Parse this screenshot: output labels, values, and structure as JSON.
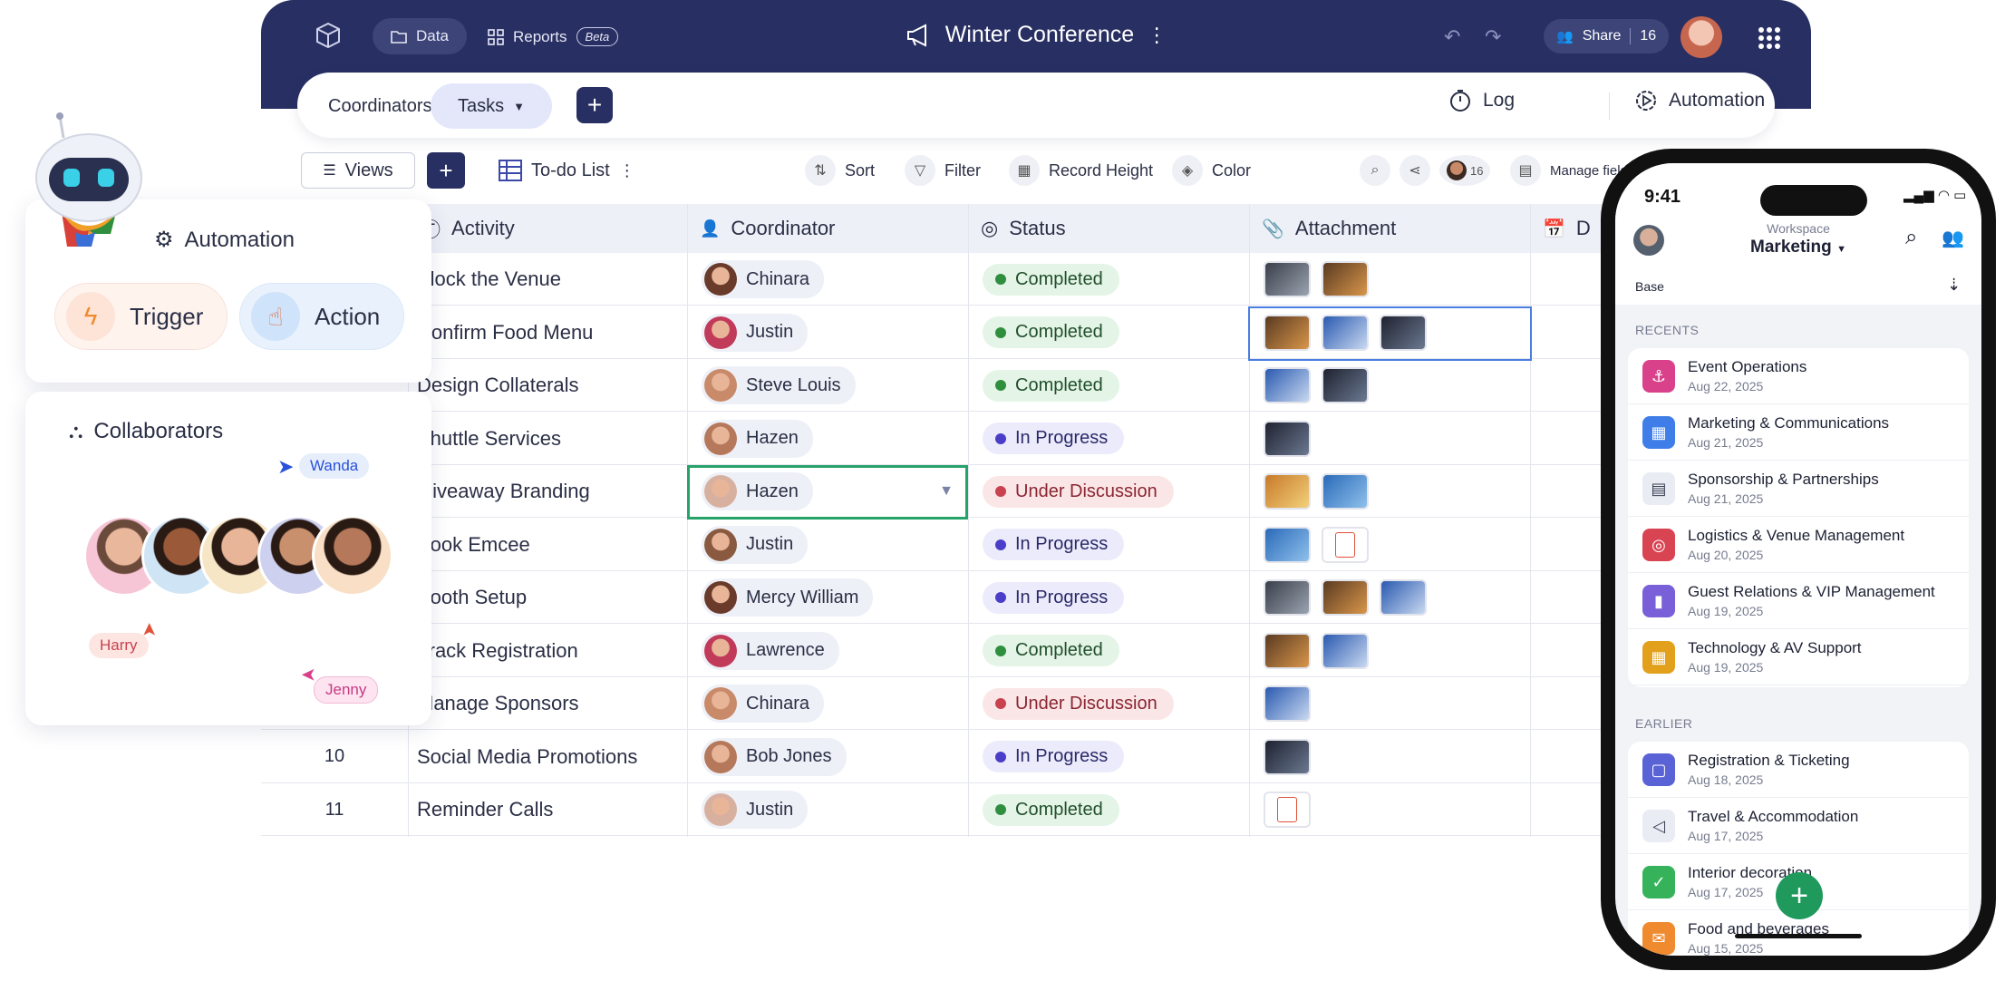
{
  "topbar": {
    "data_label": "Data",
    "reports_label": "Reports",
    "beta_label": "Beta",
    "title": "Winter Conference",
    "share_label": "Share",
    "share_count": "16"
  },
  "tabs": {
    "coordinators": "Coordinators",
    "tasks": "Tasks",
    "log": "Log",
    "automation": "Automation"
  },
  "toolbar": {
    "views": "Views",
    "list_name": "To-do List",
    "sort": "Sort",
    "filter": "Filter",
    "record_height": "Record Height",
    "color": "Color",
    "collab_count": "16",
    "manage_fields": "Manage fields"
  },
  "table": {
    "columns": [
      "Activity",
      "Coordinator",
      "Status",
      "Attachment",
      "D"
    ],
    "rows": [
      {
        "num": "",
        "activity": "Block the Venue",
        "coordinator": "Chinara",
        "status": "Completed",
        "attachments": 2,
        "pdf": false
      },
      {
        "num": "",
        "activity": "Confirm Food Menu",
        "coordinator": "Justin",
        "status": "Completed",
        "attachments": 3,
        "pdf": false
      },
      {
        "num": "",
        "activity": "Design Collaterals",
        "coordinator": "Steve Louis",
        "status": "Completed",
        "attachments": 2,
        "pdf": false
      },
      {
        "num": "",
        "activity": "Shuttle Services",
        "coordinator": "Hazen",
        "status": "In Progress",
        "attachments": 1,
        "pdf": false
      },
      {
        "num": "",
        "activity": "Giveaway Branding",
        "coordinator": "Hazen",
        "status": "Under Discussion",
        "attachments": 2,
        "pdf": false
      },
      {
        "num": "",
        "activity": "Book Emcee",
        "coordinator": "Justin",
        "status": "In Progress",
        "attachments": 1,
        "pdf": true
      },
      {
        "num": "",
        "activity": "Booth Setup",
        "coordinator": "Mercy William",
        "status": "In Progress",
        "attachments": 3,
        "pdf": false
      },
      {
        "num": "",
        "activity": "Track Registration",
        "coordinator": "Lawrence",
        "status": "Completed",
        "attachments": 2,
        "pdf": false
      },
      {
        "num": "",
        "activity": "Manage Sponsors",
        "coordinator": "Chinara",
        "status": "Under Discussion",
        "attachments": 1,
        "pdf": false
      },
      {
        "num": "10",
        "activity": "Social Media Promotions",
        "coordinator": "Bob Jones",
        "status": "In Progress",
        "attachments": 1,
        "pdf": false
      },
      {
        "num": "11",
        "activity": "Reminder Calls",
        "coordinator": "Justin",
        "status": "Completed",
        "attachments": 0,
        "pdf": true
      }
    ]
  },
  "status_colors": {
    "Completed": {
      "bg": "#e4f4e7",
      "dot": "#2f8f3e"
    },
    "In Progress": {
      "bg": "#ecebfb",
      "dot": "#4a3ec8"
    },
    "Under Discussion": {
      "bg": "#fbe6e7",
      "dot": "#c8424f"
    }
  },
  "automation_card": {
    "title": "Automation",
    "trigger": "Trigger",
    "action": "Action"
  },
  "collaborators_card": {
    "title": "Collaborators",
    "cursor_wanda": "Wanda",
    "cursor_harry": "Harry",
    "cursor_jenny": "Jenny"
  },
  "phone": {
    "time": "9:41",
    "workspace_label": "Workspace",
    "workspace_name": "Marketing",
    "base_label": "Base",
    "recents_label": "RECENTS",
    "earlier_label": "EARLIER",
    "recents": [
      {
        "name": "Event Operations",
        "date": "Aug 22, 2025",
        "color": "#d9428a",
        "icon": "⚓"
      },
      {
        "name": "Marketing & Communications",
        "date": "Aug 21, 2025",
        "color": "#3f7ee8",
        "icon": "▦"
      },
      {
        "name": "Sponsorship & Partnerships",
        "date": "Aug 21, 2025",
        "color": "#e9ecf3",
        "icon": "▤"
      },
      {
        "name": "Logistics & Venue Management",
        "date": "Aug 20, 2025",
        "color": "#d94453",
        "icon": "◎"
      },
      {
        "name": "Guest Relations & VIP Management",
        "date": "Aug 19, 2025",
        "color": "#7a60d8",
        "icon": "▮"
      },
      {
        "name": "Technology & AV Support",
        "date": "Aug 19, 2025",
        "color": "#e2a01c",
        "icon": "▦"
      }
    ],
    "earlier": [
      {
        "name": "Registration & Ticketing",
        "date": "Aug 18, 2025",
        "color": "#5a63d6",
        "icon": "▢"
      },
      {
        "name": "Travel & Accommodation",
        "date": "Aug 17, 2025",
        "color": "#e9ecf3",
        "icon": "◁"
      },
      {
        "name": "Interior decoration",
        "date": "Aug 17, 2025",
        "color": "#36b35a",
        "icon": "✓"
      },
      {
        "name": "Food and beverages",
        "date": "Aug 15, 2025",
        "color": "#f08a2e",
        "icon": "✉"
      }
    ]
  }
}
